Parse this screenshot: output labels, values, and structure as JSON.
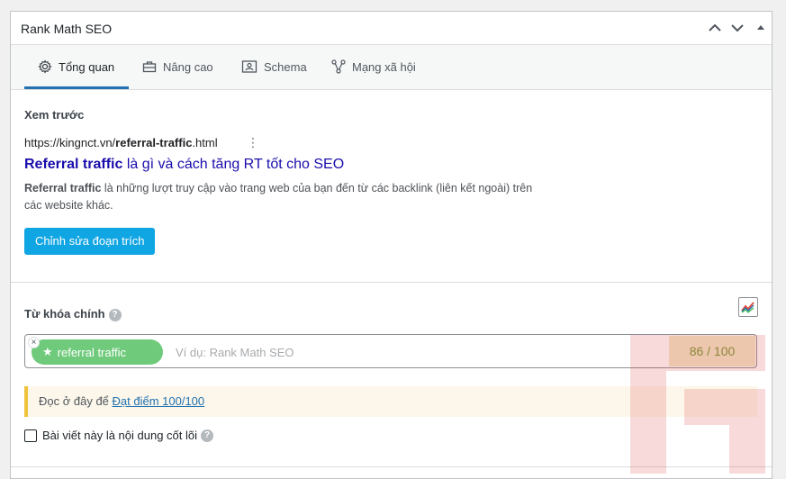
{
  "panel": {
    "title": "Rank Math SEO"
  },
  "header_icons": [
    "chevron-up-icon",
    "chevron-down-icon",
    "triangle-up-icon"
  ],
  "tabs": [
    {
      "label": "Tổng quan",
      "icon": "gear-icon",
      "active": true
    },
    {
      "label": "Nâng cao",
      "icon": "toolbox-icon",
      "active": false
    },
    {
      "label": "Schema",
      "icon": "schema-icon",
      "active": false
    },
    {
      "label": "Mạng xã hội",
      "icon": "share-icon",
      "active": false
    }
  ],
  "preview": {
    "heading": "Xem trước",
    "url_prefix": "https://kingnct.vn/",
    "url_slug": "referral-traffic",
    "url_suffix": ".html",
    "title_keyword": "Referral traffic",
    "title_rest": " là gì và cách tăng RT tốt cho SEO",
    "desc_keyword": "Referral traffic",
    "desc_rest_line1": " là những lượt truy cập vào trang web của bạn đến từ các backlink (liên kết ngoài) trên",
    "desc_line2": "các website khác.",
    "edit_button": "Chỉnh sửa đoạn trích"
  },
  "focus_keyword": {
    "heading": "Từ khóa chính",
    "help": "?",
    "tag": "referral traffic",
    "placeholder": "Ví dụ: Rank Math SEO",
    "score": "86 / 100"
  },
  "notice": {
    "text": "Đọc ở đây để ",
    "link": "Đạt điểm 100/100"
  },
  "pillar": {
    "label": "Bài viết này là nội dung cốt lõi",
    "help": "?",
    "checked": false
  },
  "colors": {
    "accent": "#2271b1",
    "primary_button": "#10a5e3",
    "tag_green": "#6fca7b",
    "notice_border": "#f0c33c",
    "serp_title": "#1a0dab"
  }
}
